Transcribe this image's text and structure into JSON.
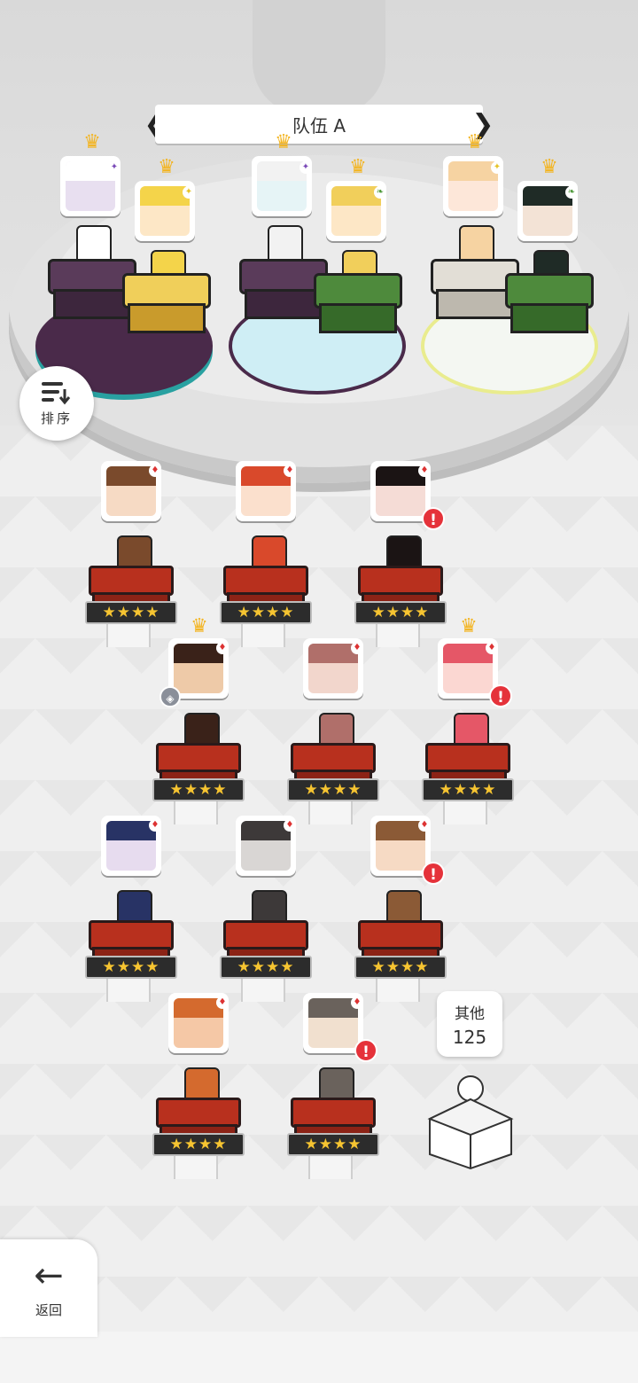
{
  "team": {
    "name": "队伍 A",
    "prev_arrow": "❮",
    "next_arrow": "❯"
  },
  "team_members": [
    {
      "crown": true,
      "element": "dark",
      "portrait_color": "#e8dff0",
      "hair_color": "#ffffff"
    },
    {
      "crown": true,
      "element": "light",
      "portrait_color": "#fde7c6",
      "hair_color": "#f4d44a"
    },
    {
      "crown": true,
      "element": "dark",
      "portrait_color": "#e6f4f6",
      "hair_color": "#f2f2f2"
    },
    {
      "crown": true,
      "element": "earth",
      "portrait_color": "#fde7c6",
      "hair_color": "#f1cf5b"
    },
    {
      "crown": true,
      "element": "light",
      "portrait_color": "#fde7d9",
      "hair_color": "#f6d3a2"
    },
    {
      "crown": true,
      "element": "earth",
      "portrait_color": "#f3e3d6",
      "hair_color": "#1f2b26"
    }
  ],
  "sort_button": {
    "label": "排序"
  },
  "roster": [
    {
      "stars": "★★★★",
      "crown": false,
      "alert": false,
      "layer": false,
      "portrait_color": "#f6dac4",
      "hair_color": "#7a4a2c"
    },
    {
      "stars": "★★★★",
      "crown": false,
      "alert": false,
      "layer": false,
      "portrait_color": "#fbe0cd",
      "hair_color": "#d9492b"
    },
    {
      "stars": "★★★★",
      "crown": false,
      "alert": true,
      "alert_text": "!",
      "layer": false,
      "portrait_color": "#f5dcd6",
      "hair_color": "#1b1414"
    },
    {
      "stars": "★★★★",
      "crown": true,
      "alert": false,
      "layer": true,
      "portrait_color": "#eecaa8",
      "hair_color": "#3a2219"
    },
    {
      "stars": "★★★★",
      "crown": false,
      "alert": false,
      "layer": false,
      "portrait_color": "#f2d6cc",
      "hair_color": "#b06f6a"
    },
    {
      "stars": "★★★★",
      "crown": true,
      "alert": true,
      "alert_text": "!",
      "layer": false,
      "portrait_color": "#fbd7d2",
      "hair_color": "#e55767"
    },
    {
      "stars": "★★★★",
      "crown": false,
      "alert": false,
      "layer": false,
      "portrait_color": "#e7dcef",
      "hair_color": "#283365"
    },
    {
      "stars": "★★★★",
      "crown": false,
      "alert": false,
      "layer": false,
      "portrait_color": "#d9d6d4",
      "hair_color": "#3d3939"
    },
    {
      "stars": "★★★★",
      "crown": false,
      "alert": true,
      "alert_text": "!",
      "layer": false,
      "portrait_color": "#f6dac4",
      "hair_color": "#8b5a36"
    },
    {
      "stars": "★★★★",
      "crown": false,
      "alert": false,
      "layer": false,
      "portrait_color": "#f5c8a6",
      "hair_color": "#d46a2e"
    },
    {
      "stars": "★★★★",
      "crown": false,
      "alert": true,
      "alert_text": "!",
      "layer": false,
      "portrait_color": "#f1e0cf",
      "hair_color": "#6a625c"
    }
  ],
  "others": {
    "label": "其他",
    "count": "125"
  },
  "back_button": {
    "label": "返回",
    "arrow": "←"
  },
  "colors": {
    "alert": "#e5323a",
    "star": "#f6c431",
    "crown": "#f3b420",
    "pedestal": "#b8301e"
  }
}
